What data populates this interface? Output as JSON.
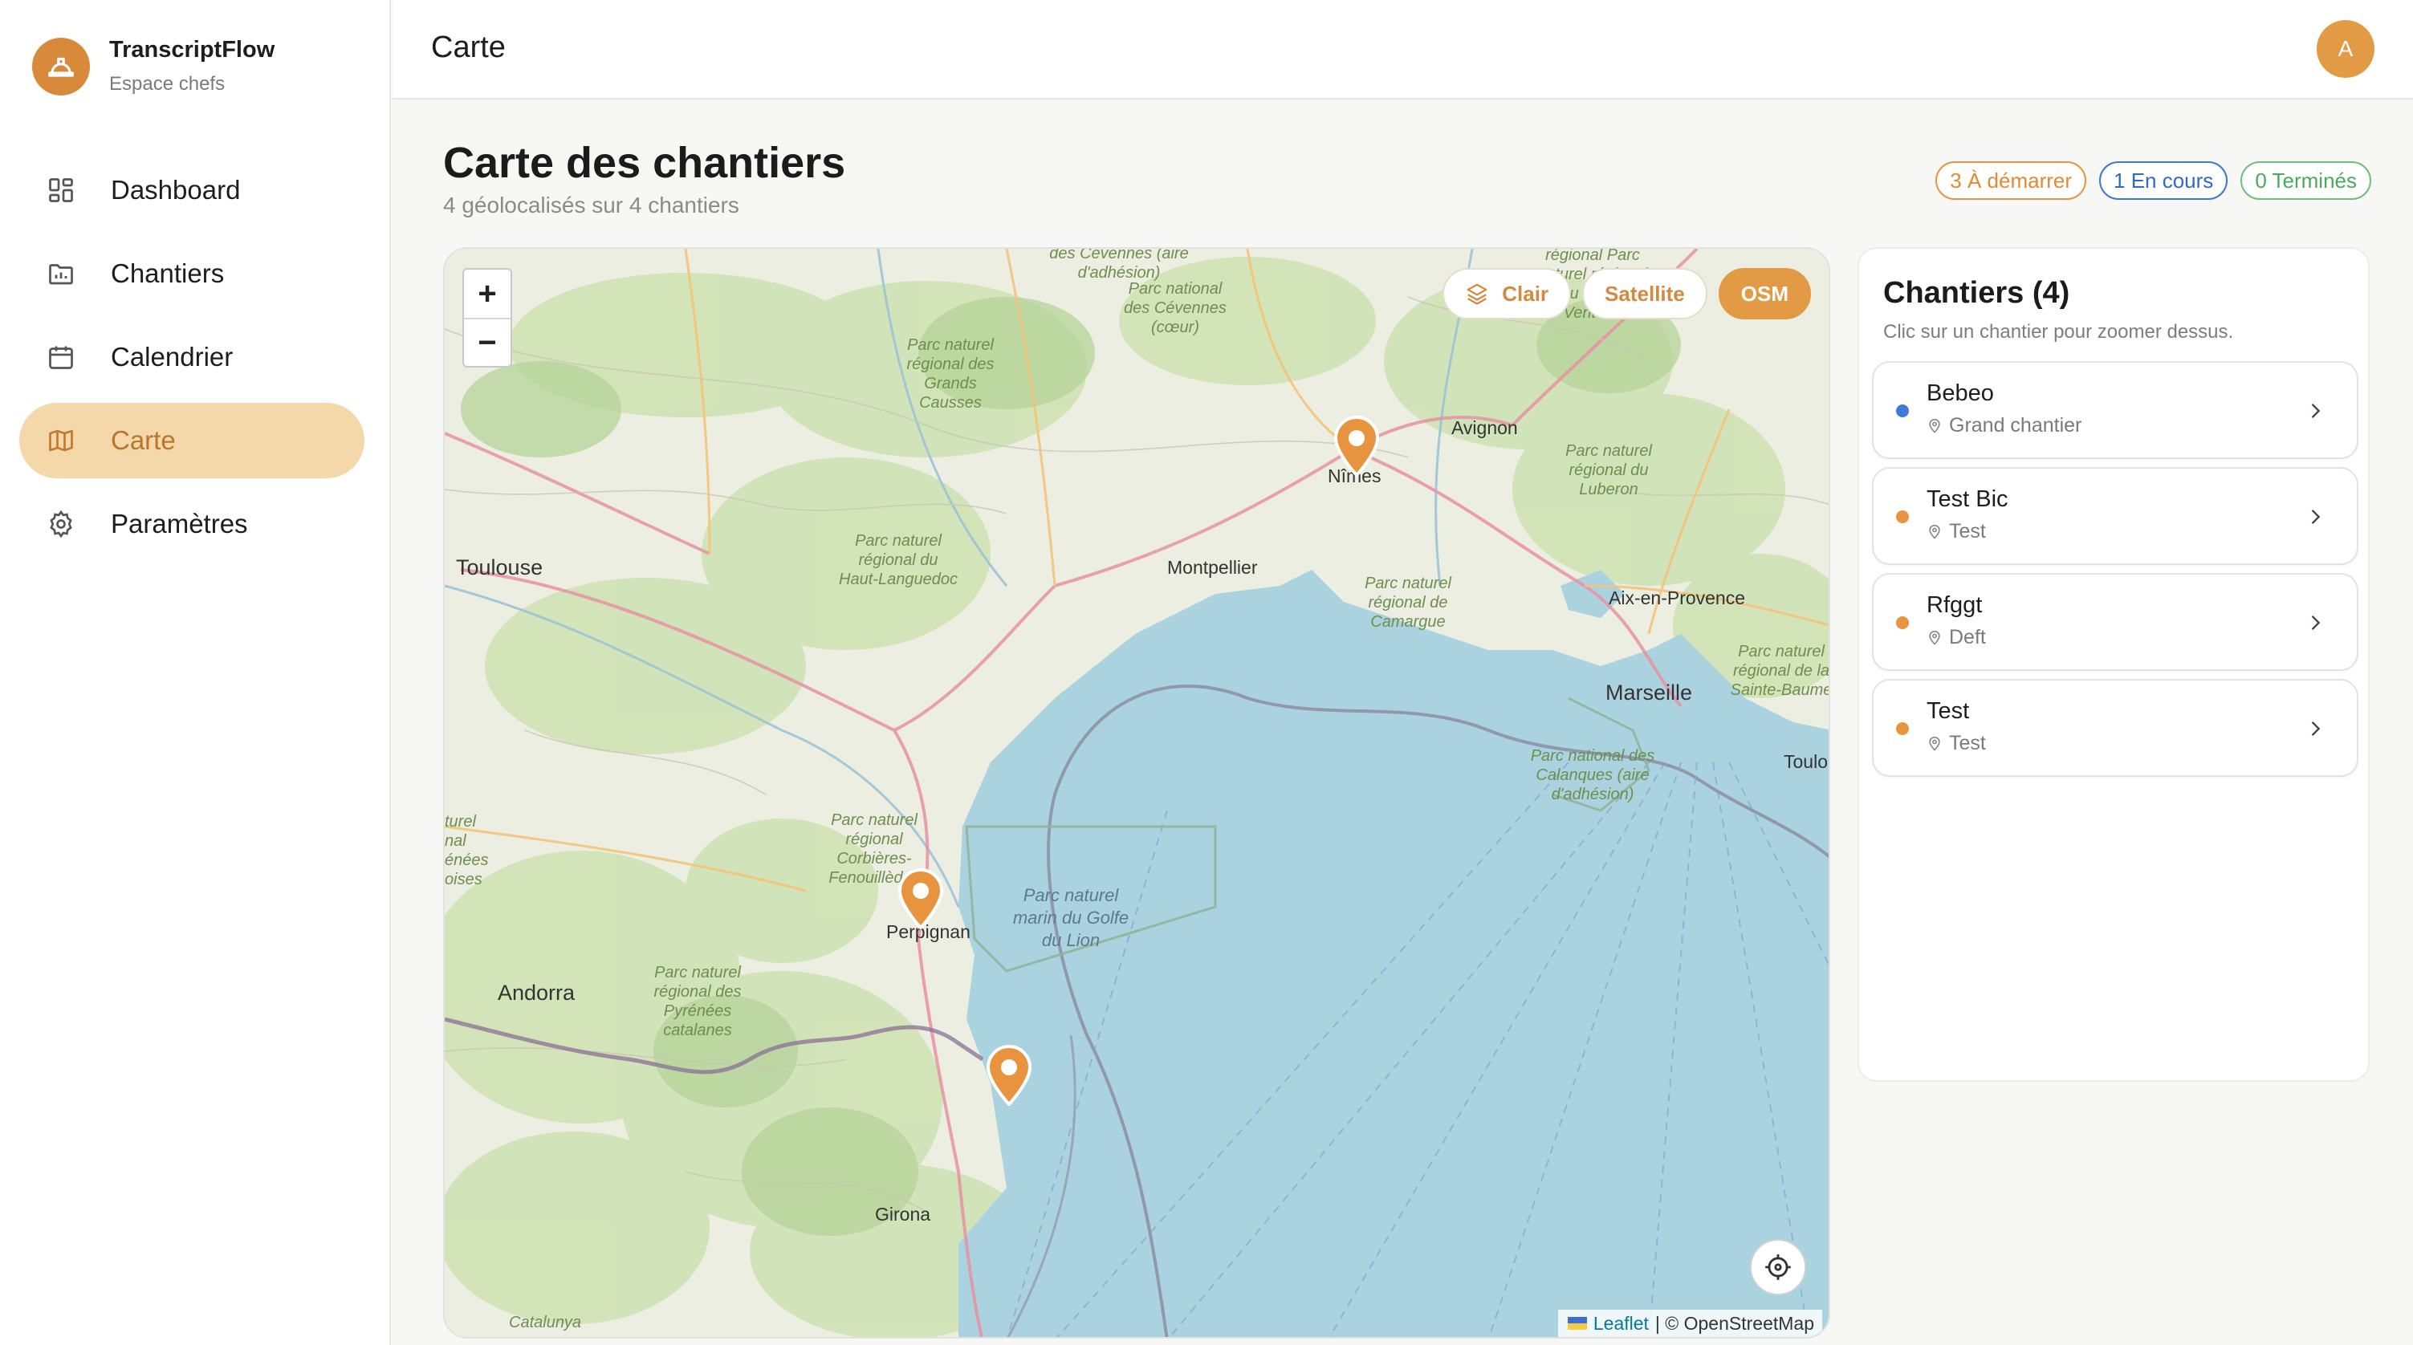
{
  "brand": {
    "name": "TranscriptFlow",
    "subtitle": "Espace chefs"
  },
  "nav": [
    {
      "label": "Dashboard",
      "icon": "dashboard-icon"
    },
    {
      "label": "Chantiers",
      "icon": "folder-chart-icon"
    },
    {
      "label": "Calendrier",
      "icon": "calendar-icon"
    },
    {
      "label": "Carte",
      "icon": "map-icon",
      "active": true
    },
    {
      "label": "Paramètres",
      "icon": "gear-icon"
    }
  ],
  "topbar": {
    "title": "Carte",
    "avatar_initial": "A"
  },
  "page": {
    "title": "Carte des chantiers",
    "subtitle": "4 géolocalisés sur 4 chantiers"
  },
  "badges": [
    {
      "label": "3 À démarrer",
      "color": "#e08a34"
    },
    {
      "label": "1 En cours",
      "color": "#2f68c8"
    },
    {
      "label": "0 Terminés",
      "color": "#4aa95a"
    }
  ],
  "map": {
    "zoom_in": "+",
    "zoom_out": "−",
    "layers": [
      {
        "label": "Clair",
        "icon": "layers-icon"
      },
      {
        "label": "Satellite"
      },
      {
        "label": "OSM",
        "active": true
      }
    ],
    "labels": {
      "toulouse": "Toulouse",
      "montpellier": "Montpellier",
      "nimes": "Nîmes",
      "avignon": "Avignon",
      "aix": "Aix-en-Provence",
      "marseille": "Marseille",
      "toulon": "Toulo",
      "perpignan": "Perpignan",
      "girona": "Girona",
      "andorra": "Andorra",
      "catalunya": "Catalunya",
      "cevennes_top": "des Cévennes (aire d'adhésion)",
      "cevennes": "Parc national des Cévennes (cœur)",
      "grands_causses": "Parc naturel régional des Grands Causses",
      "haut_languedoc": "Parc naturel régional du Haut-Languedoc",
      "mont_ventoux": "régional Parc naturel régional du Mont-Ventoux",
      "luberon": "Parc naturel régional du Luberon",
      "camargue": "Parc naturel régional de Camargue",
      "sainte_baume": "Parc naturel régional de la Sainte-Baume",
      "calanques": "Parc national des Calanques (aire d'adhésion)",
      "corbieres": "Parc naturel régional Corbières-Fenouillèdes",
      "pyrenees": "Parc naturel régional des Pyrénées catalanes",
      "golfe_lion": "Parc naturel marin du Golfe du Lion",
      "west_park": "turel nal énées oises"
    },
    "attribution": {
      "leaflet": "Leaflet",
      "osm": "| © OpenStreetMap"
    }
  },
  "panel": {
    "title": "Chantiers (4)",
    "subtitle": "Clic sur un chantier pour zoomer dessus.",
    "items": [
      {
        "name": "Bebeo",
        "location": "Grand chantier",
        "status_color": "#3f78d8"
      },
      {
        "name": "Test Bic",
        "location": "Test",
        "status_color": "#e8943e"
      },
      {
        "name": "Rfggt",
        "location": "Deft",
        "status_color": "#e8943e"
      },
      {
        "name": "Test",
        "location": "Test",
        "status_color": "#e8943e"
      }
    ]
  }
}
